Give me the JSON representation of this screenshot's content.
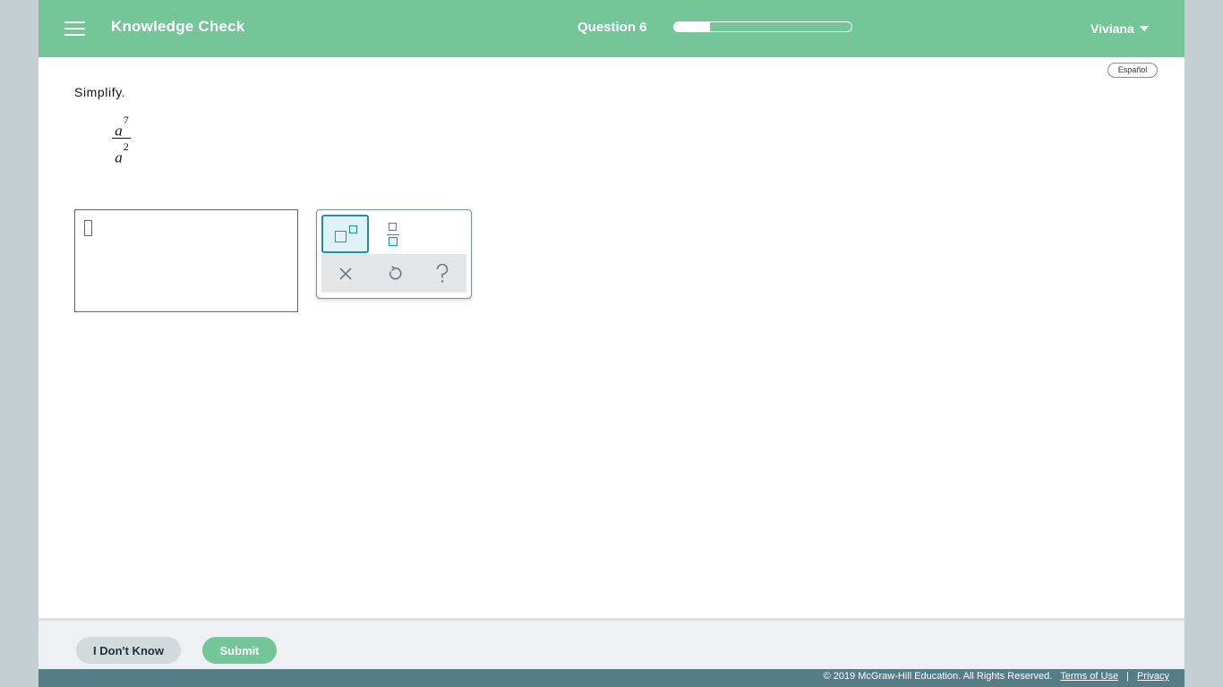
{
  "header": {
    "title": "Knowledge Check",
    "question_label": "Question 6",
    "progress_percent": 20,
    "user_name": "Viviana"
  },
  "language_button": "Español",
  "problem": {
    "prompt": "Simplify.",
    "numerator_base": "a",
    "numerator_exponent": "7",
    "denominator_base": "a",
    "denominator_exponent": "2"
  },
  "answer": {
    "value": ""
  },
  "palette": {
    "tools": [
      "exponent-tool",
      "fraction-tool"
    ],
    "actions": [
      "clear-icon",
      "undo-icon",
      "help-icon"
    ]
  },
  "footer": {
    "dont_know_label": "I Don't Know",
    "submit_label": "Submit",
    "copyright": "© 2019 McGraw-Hill Education. All Rights Reserved.",
    "terms_label": "Terms of Use",
    "separator": "|",
    "privacy_label": "Privacy"
  },
  "colors": {
    "header_green": "#74c698",
    "accent_teal": "#1f8fa6",
    "footer_blue": "#557c87"
  }
}
